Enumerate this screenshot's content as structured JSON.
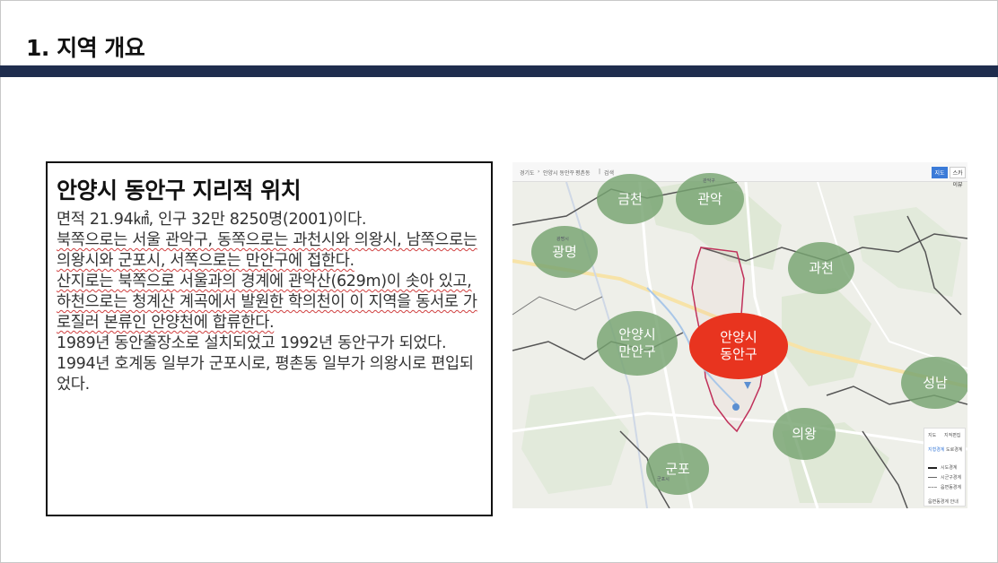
{
  "header": {
    "title": "1. 지역 개요"
  },
  "content": {
    "heading": "안양시 동안구 지리적 위치",
    "paragraphs": [
      "면적 21.94㎢, 인구 32만 8250명(2001)이다.",
      "북쪽으로는 서울 관악구, 동쪽으로는 과천시와 의왕시, 남쪽으로는 의왕시와 군포시, 서쪽으로는 만안구에 접한다.",
      "산지로는 북쪽으로 서울과의 경계에 관악산(629m)이 솟아 있고, 하천으로는 청계산 계곡에서 발원한 학의천이 이 지역을 동서로 가로질러 본류인 안양천에 합류한다.",
      "1989년 동안출장소로 설치되었고 1992년 동안구가 되었다. 1994년 호계동 일부가 군포시로, 평촌동 일부가 의왕시로 편입되었다."
    ]
  },
  "map": {
    "breadcrumb": [
      "경기도",
      "안양시 동안구",
      "평촌동",
      "검색"
    ],
    "buttons": {
      "primary": "지도",
      "secondary": "스카이뷰"
    },
    "regions": {
      "geumcheon": "금천",
      "gwanak": "관악",
      "gwangmyeong": "광명",
      "gwacheon": "과천",
      "manan_line1": "안양시",
      "manan_line2": "만안구",
      "dongan_line1": "안양시",
      "dongan_line2": "동안구",
      "seongnam": "성남",
      "uiwang": "의왕",
      "gunpo": "군포"
    },
    "sublabels": {
      "gwanak": "관악구",
      "gwangmyeong": "광명시",
      "gunpo": "군포시"
    },
    "legend": {
      "tabs": [
        "지도",
        "지적편집"
      ],
      "subtabs": [
        "지형경계",
        "도로경계"
      ],
      "items": [
        "시도경계",
        "시군구경계",
        "읍면동경계"
      ],
      "footer": "읍면동경계 안내"
    },
    "colors": {
      "bubble": "#76a370",
      "highlight": "#e8341f",
      "boundary": "#c0305a"
    }
  }
}
